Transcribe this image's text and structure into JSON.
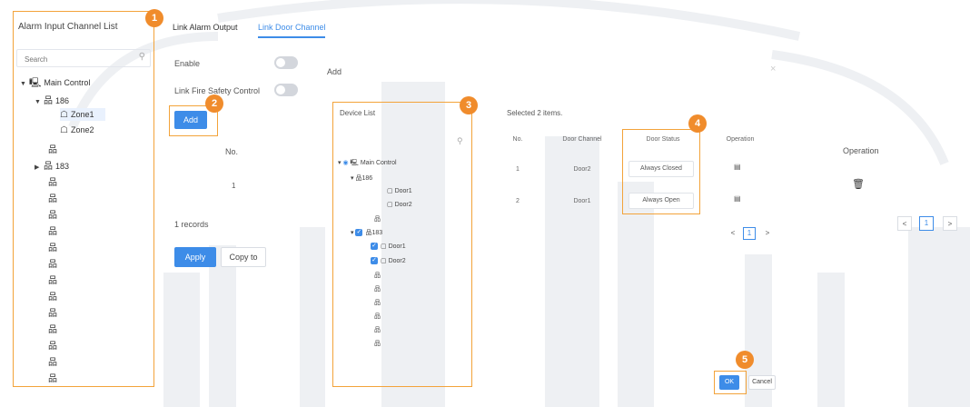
{
  "left_panel": {
    "title": "Alarm Input Channel List",
    "search_placeholder": "Search",
    "tree": {
      "root": "Main Control",
      "node_186": "186",
      "zone1": "Zone1",
      "zone2": "Zone2",
      "node_183": "183"
    }
  },
  "tabs": [
    {
      "label": "Link Alarm Output"
    },
    {
      "label": "Link Door Channel"
    }
  ],
  "form": {
    "enable_label": "Enable",
    "fire_label": "Link Fire Safety Control",
    "add_button": "Add",
    "col_no": "No.",
    "row_no": "1",
    "records": "1 records",
    "apply_button": "Apply",
    "copy_button": "Copy to"
  },
  "right_col": {
    "operation_header": "Operation",
    "delete_icon": "trash-icon",
    "pager_prev": "<",
    "pager_page": "1",
    "pager_next": ">"
  },
  "dialog": {
    "title": "Add",
    "close": "×",
    "device_list_title": "Device List",
    "device_tree": {
      "root": "Main Control",
      "n186": "186",
      "d186_1": "Door1",
      "d186_2": "Door2",
      "n183": "183",
      "d183_1": "Door1",
      "d183_2": "Door2"
    },
    "selected_text": "Selected 2 items.",
    "columns": [
      "No.",
      "Door Channel",
      "Door Status",
      "Operation"
    ],
    "rows": [
      {
        "no": "1",
        "channel": "Door2",
        "status": "Always Closed"
      },
      {
        "no": "2",
        "channel": "Door1",
        "status": "Always Open"
      }
    ],
    "pager_prev": "<",
    "pager_page": "1",
    "pager_next": ">",
    "ok_button": "OK",
    "cancel_button": "Cancel"
  },
  "badges": [
    "1",
    "2",
    "3",
    "4",
    "5"
  ],
  "colors": {
    "accent": "#3d8ce8",
    "highlight": "#f3a33a",
    "badge": "#f08c2c"
  }
}
